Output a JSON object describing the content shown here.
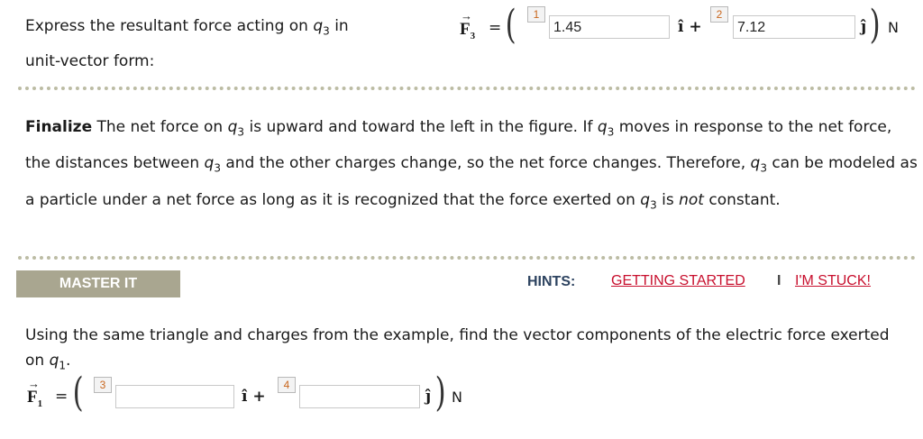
{
  "question1": {
    "prompt_line1_prefix": "Express the resultant force acting on ",
    "prompt_line1_var": "q",
    "prompt_line1_sub": "3",
    "prompt_line1_suffix": " in",
    "prompt_line2": "unit-vector form:"
  },
  "answer1": {
    "vector": "F",
    "vector_sub": "3",
    "equals": "=",
    "badge_i": "1",
    "value_i": "1.45",
    "unit_i": "î +",
    "badge_j": "2",
    "value_j": "7.12",
    "unit_j": "ĵ",
    "units": "N"
  },
  "finalize": {
    "label": "Finalize",
    "t1": " The net force on ",
    "t2": " is upward and toward the left in the figure. If ",
    "t3": " moves in response to the net force, the distances between ",
    "t4": " and the other charges change, so the net force changes. Therefore, ",
    "t5": " can be modeled as a particle under a net force as long as it is recognized that the force exerted on ",
    "t6": " is ",
    "emph": "not",
    "t7": " constant.",
    "var": "q",
    "sub": "3"
  },
  "master": {
    "label": "MASTER IT",
    "hints_label": "HINTS:",
    "getting_started": "GETTING STARTED",
    "separator": "I",
    "im_stuck": "I'M STUCK!"
  },
  "question2": {
    "prompt": "Using the same triangle and charges from the example, find the vector components of the electric force exerted on ",
    "var": "q",
    "sub": "1",
    "end": "."
  },
  "answer2": {
    "vector": "F",
    "vector_sub": "1",
    "equals": "=",
    "badge_i": "3",
    "value_i": "",
    "unit_i": "î +",
    "badge_j": "4",
    "value_j": "",
    "unit_j": "ĵ",
    "units": "N"
  },
  "colors": {
    "badge_number": "#c9671e",
    "master_bar": "#a9a690",
    "hints_label": "#2d4360",
    "link": "#c8102e",
    "dotted_rule": "#bcbca4"
  }
}
